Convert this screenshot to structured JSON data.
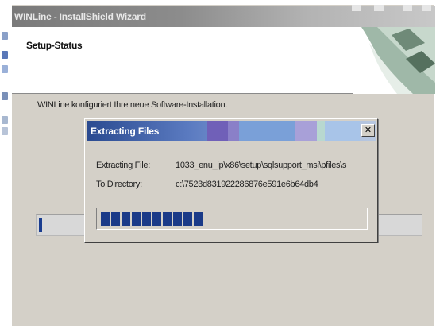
{
  "window": {
    "title": "WINLine - InstallShield Wizard"
  },
  "header": {
    "title": "Setup-Status"
  },
  "status": {
    "text": "WINLine konfiguriert Ihre neue Software-Installation."
  },
  "main_progress": {
    "value_percent": 1
  },
  "dialog": {
    "title": "Extracting Files",
    "close_glyph": "✕",
    "extracting_label": "Extracting File:",
    "extracting_value": "1033_enu_ip\\x86\\setup\\sqlsupport_msi\\pfiles\\s",
    "directory_label": "To Directory:",
    "directory_value": "c:\\7523d831922286876e591e6b64db4",
    "progress": {
      "filled_segments": 10,
      "total_segments": 30
    }
  },
  "colors": {
    "progress_fill": "#1a3a88",
    "dialog_title_start": "#2a4a90",
    "window_bg": "#d4d0c8"
  },
  "icons": {
    "close": "close-icon",
    "header_graphic": "installshield-corner-graphic"
  }
}
